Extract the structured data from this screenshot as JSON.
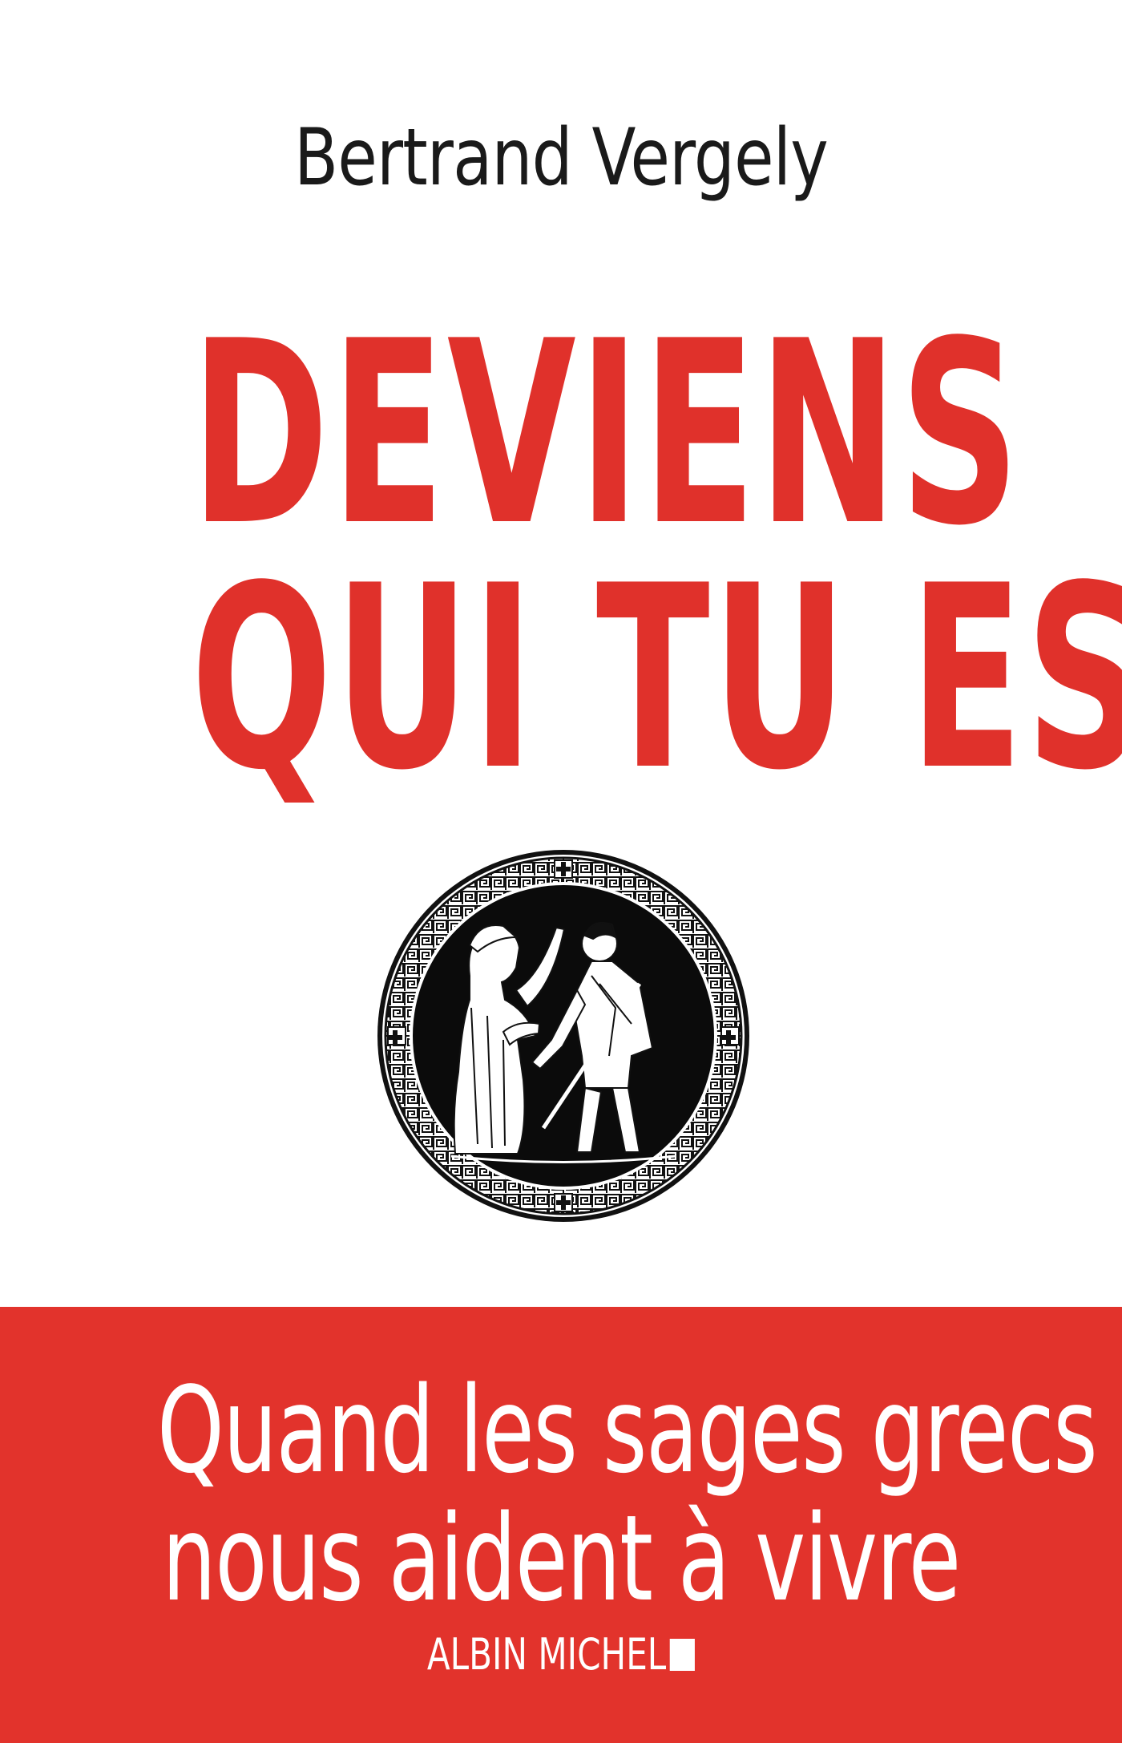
{
  "book": {
    "author": "Bertrand Vergely",
    "title_line1": "DEVIENS",
    "title_line2": "QUI TU ES",
    "subtitle_line1": "Quand les sages grecs",
    "subtitle_line2": "nous aident à vivre",
    "publisher": "ALBIN MICHEL"
  },
  "colors": {
    "title_red": "#e0312b",
    "band_red": "#e2332c",
    "author_text": "#1a1a1a",
    "background": "#ffffff"
  },
  "illustration": {
    "icon": "greek-vase-medallion-icon"
  }
}
